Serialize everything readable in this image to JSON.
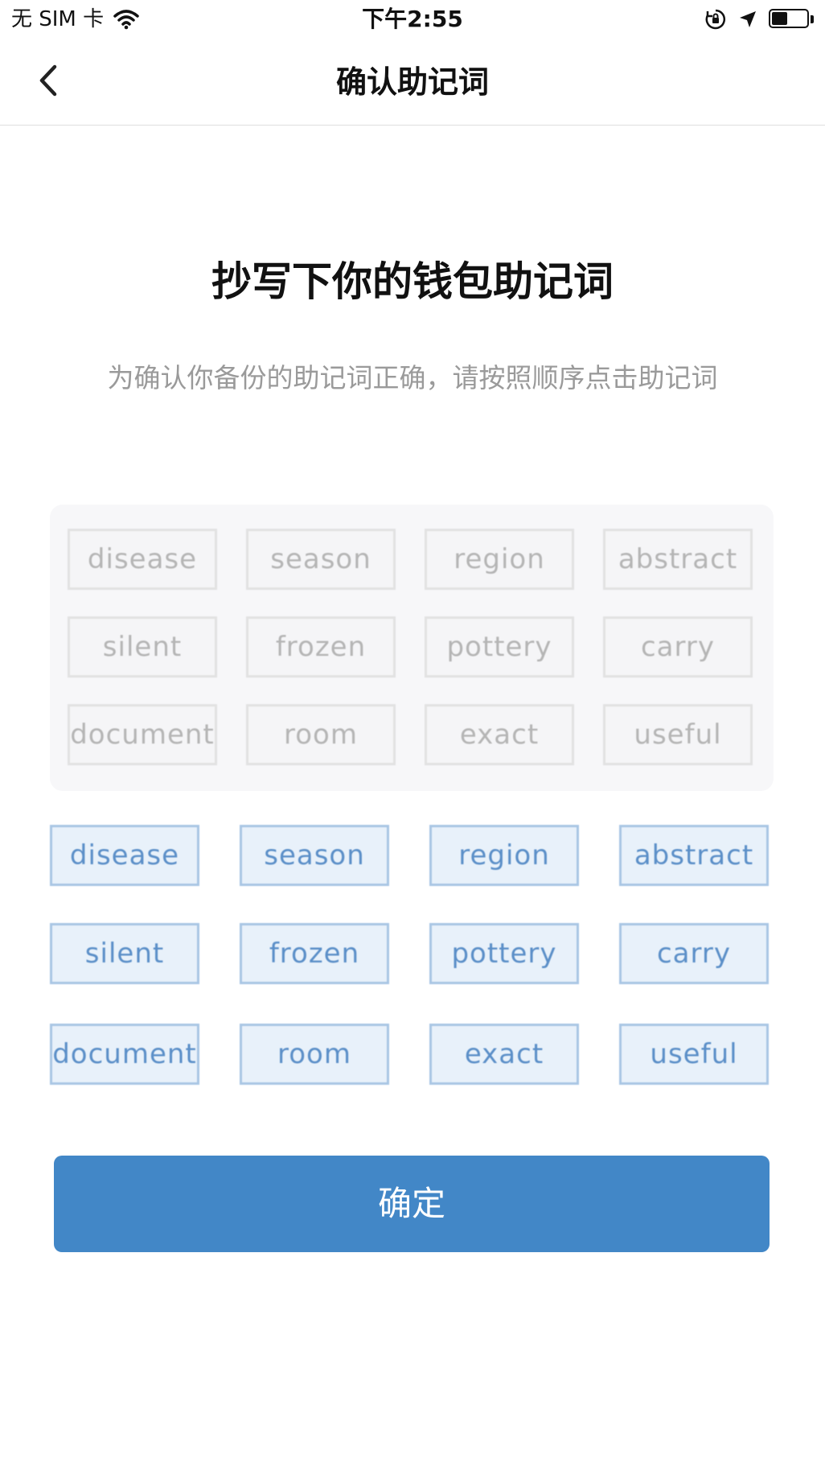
{
  "status_bar": {
    "carrier": "无 SIM 卡",
    "time": "下午2:55",
    "battery_level": 0.45,
    "icons": [
      "wifi-icon",
      "orientation-lock-icon",
      "location-arrow-icon",
      "battery-icon"
    ]
  },
  "nav": {
    "title": "确认助记词",
    "back_icon": "chevron-left-icon"
  },
  "page": {
    "title": "抄写下你的钱包助记词",
    "subtitle": "为确认你备份的助记词正确，请按照顺序点击助记词"
  },
  "selected_words": [
    "disease",
    "season",
    "region",
    "abstract",
    "silent",
    "frozen",
    "pottery",
    "carry",
    "document",
    "room",
    "exact",
    "useful"
  ],
  "word_options": [
    "disease",
    "season",
    "region",
    "abstract",
    "silent",
    "frozen",
    "pottery",
    "carry",
    "document",
    "room",
    "exact",
    "useful"
  ],
  "confirm_label": "确定",
  "colors": {
    "primary": "#4287c7",
    "option_bg": "#e8f1fa",
    "option_border": "#a9c6e4",
    "selected_bg": "#f5f5f7",
    "panel_bg": "#f7f7f9"
  }
}
